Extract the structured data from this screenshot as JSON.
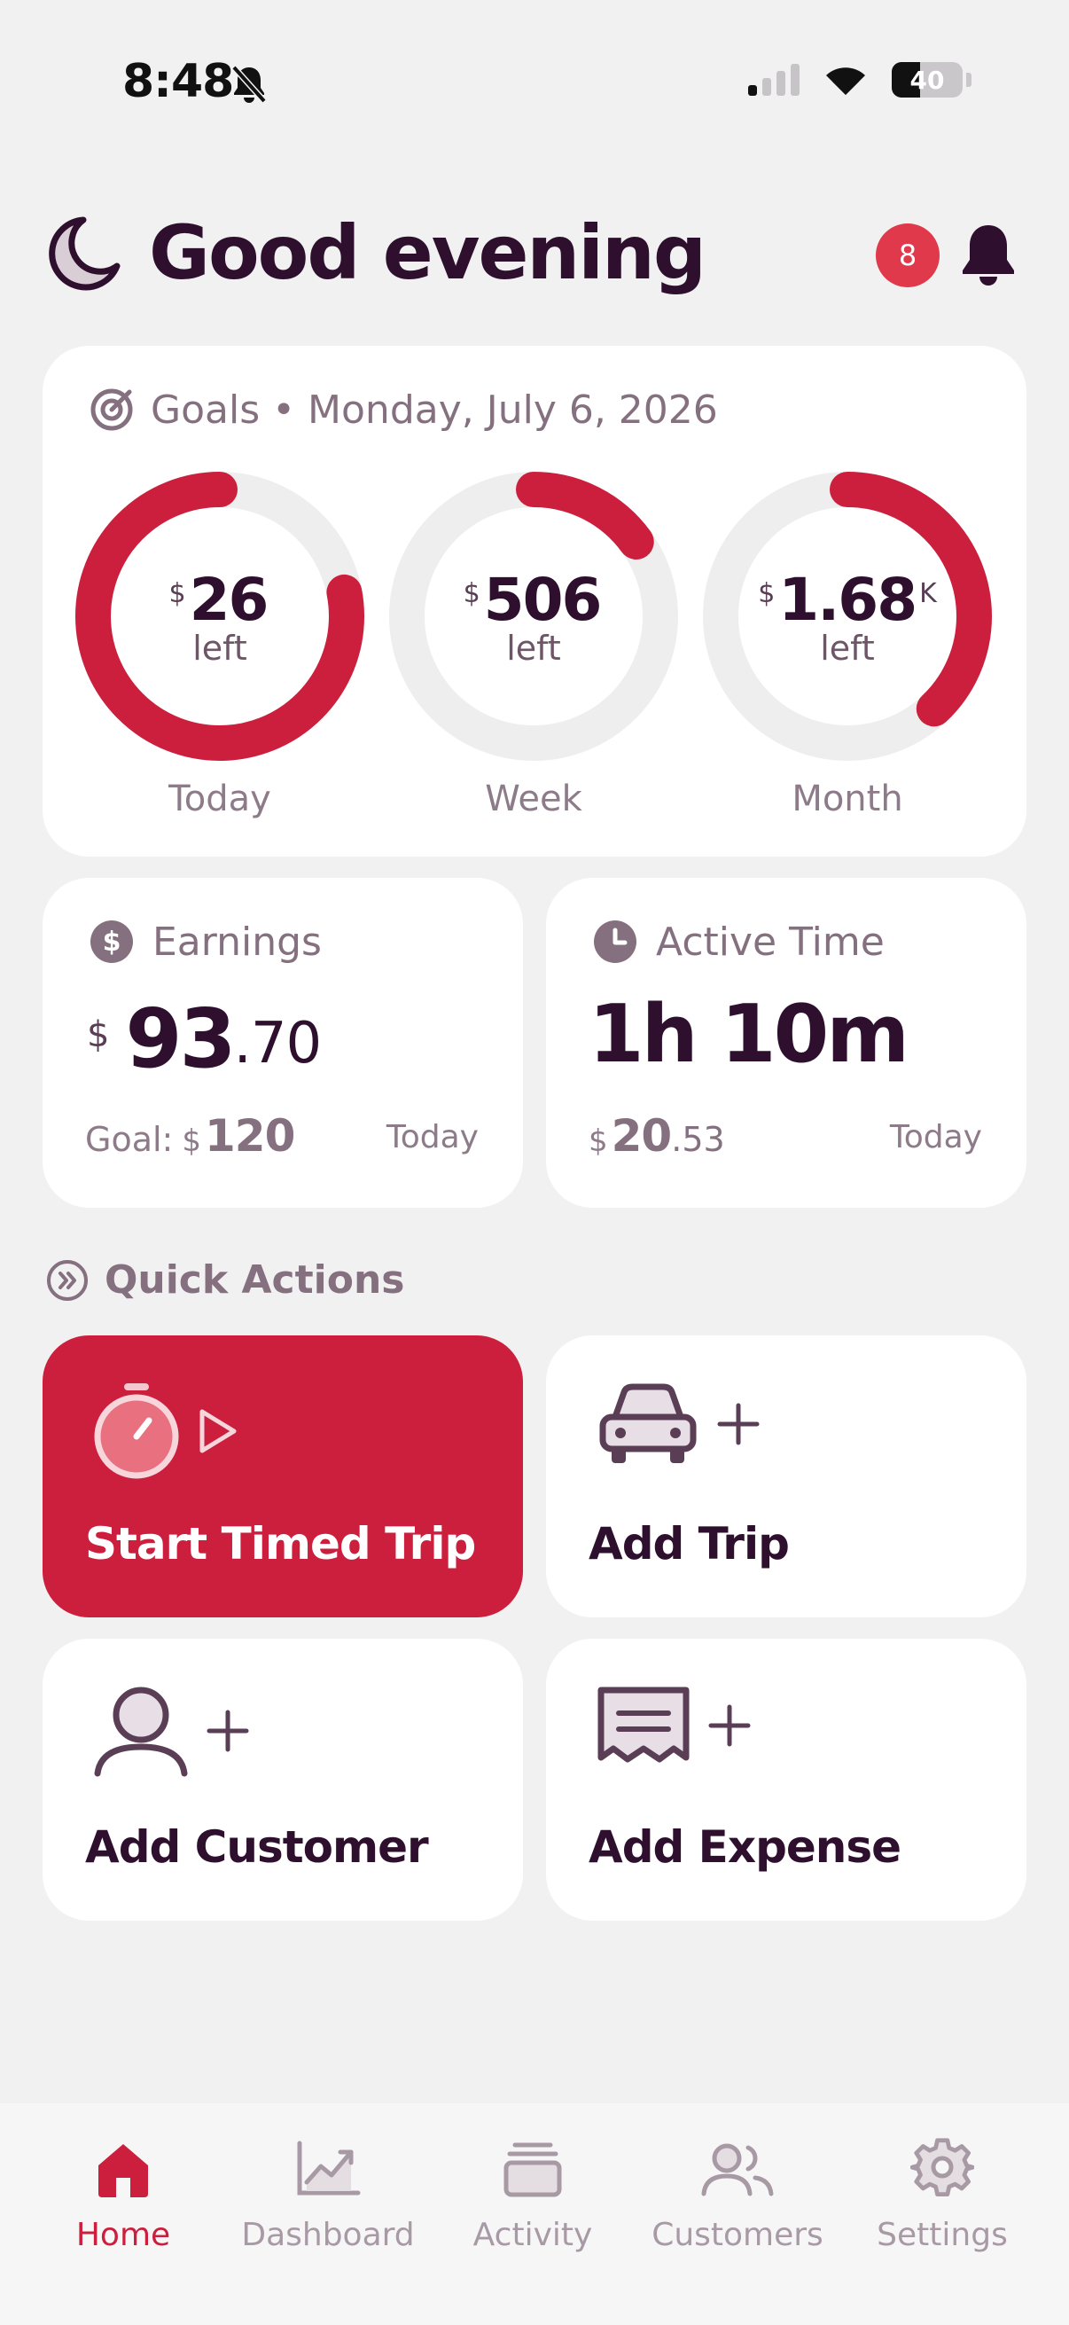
{
  "status_bar": {
    "time": "8:48",
    "battery_level": "40",
    "battery_fraction": 0.4
  },
  "header": {
    "greeting": "Good evening",
    "notification_count": "8"
  },
  "goals": {
    "title": "Goals • Monday, July 6, 2026",
    "rings": [
      {
        "period": "Today",
        "currency": "$",
        "amount": "26",
        "suffix": "",
        "sub": "left",
        "progress": 0.78
      },
      {
        "period": "Week",
        "currency": "$",
        "amount": "506",
        "suffix": "",
        "sub": "left",
        "progress": 0.15
      },
      {
        "period": "Month",
        "currency": "$",
        "amount": "1.68",
        "suffix": "K",
        "sub": "left",
        "progress": 0.38
      }
    ],
    "accent": "#cc1f3e"
  },
  "earnings": {
    "title": "Earnings",
    "currency": "$",
    "amount_whole": "93",
    "amount_cents": ".70",
    "goal_label": "Goal:",
    "goal_currency": "$",
    "goal_amount": "120",
    "period": "Today"
  },
  "active_time": {
    "title": "Active Time",
    "value": "1h 10m",
    "rate_currency": "$",
    "rate_whole": "20",
    "rate_cents": ".53",
    "period": "Today"
  },
  "quick_actions": {
    "title": "Quick Actions",
    "items": [
      {
        "label": "Start Timed Trip",
        "icon": "stopwatch-play-icon"
      },
      {
        "label": "Add Trip",
        "icon": "car-plus-icon"
      },
      {
        "label": "Add Customer",
        "icon": "user-plus-icon"
      },
      {
        "label": "Add Expense",
        "icon": "receipt-plus-icon"
      }
    ]
  },
  "tabs": [
    {
      "label": "Home",
      "icon": "home-icon",
      "active": true
    },
    {
      "label": "Dashboard",
      "icon": "chart-icon",
      "active": false
    },
    {
      "label": "Activity",
      "icon": "stack-icon",
      "active": false
    },
    {
      "label": "Customers",
      "icon": "users-icon",
      "active": false
    },
    {
      "label": "Settings",
      "icon": "gear-icon",
      "active": false
    }
  ]
}
